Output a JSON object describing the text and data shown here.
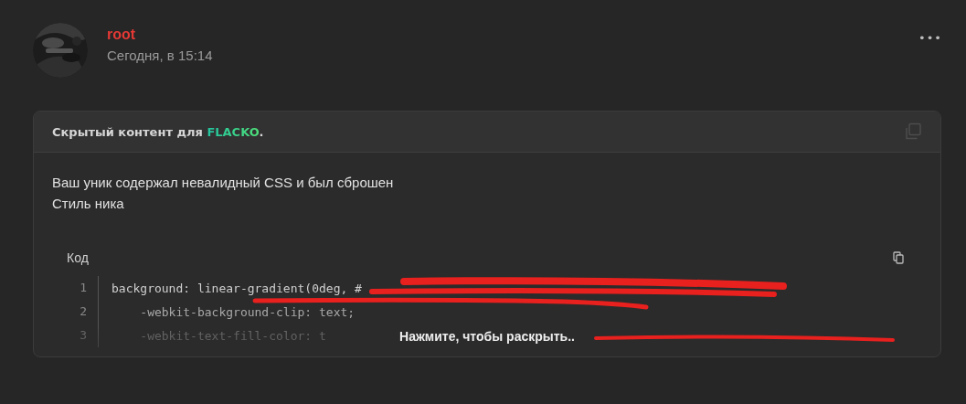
{
  "post": {
    "author": "root",
    "timestamp": "Сегодня, в 15:14",
    "menu": "•••"
  },
  "spoiler": {
    "title": "Скрытый контент для ",
    "recipient": "FLACKO",
    "title_end": ".",
    "body_lines": [
      "Ваш уник содержал невалидный CSS и был сброшен",
      "Стиль ника"
    ],
    "code": {
      "label": "Код",
      "collapsed": true,
      "expand_hint": "Нажмите, чтобы раскрыть..",
      "lines": [
        {
          "number": "1",
          "text": "background: linear-gradient(0deg, #"
        },
        {
          "number": "2",
          "text": "    -webkit-background-clip: text;"
        },
        {
          "number": "3",
          "text": "    -webkit-text-fill-color: t"
        }
      ]
    }
  }
}
